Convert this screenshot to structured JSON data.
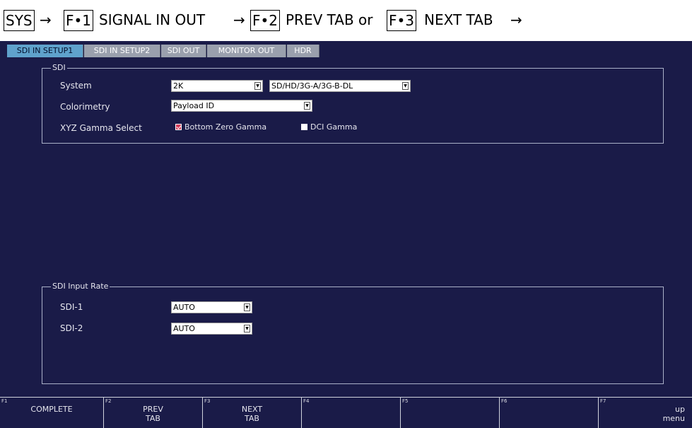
{
  "breadcrumb": {
    "sys": "SYS",
    "arrow": "→",
    "f1_key": "F•1",
    "f1_text": "SIGNAL IN OUT",
    "f2_key": "F•2",
    "f2_text": "PREV TAB or",
    "f3_key": "F•3",
    "f3_text": "NEXT TAB"
  },
  "tabs": [
    {
      "label": "SDI IN SETUP1",
      "active": true
    },
    {
      "label": "SDI IN SETUP2",
      "active": false
    },
    {
      "label": "SDI OUT",
      "active": false
    },
    {
      "label": "MONITOR OUT",
      "active": false
    },
    {
      "label": "HDR",
      "active": false
    }
  ],
  "sdi": {
    "legend": "SDI",
    "system_label": "System",
    "system_value": "2K",
    "system_mode_value": "SD/HD/3G-A/3G-B-DL",
    "colorimetry_label": "Colorimetry",
    "colorimetry_value": "Payload ID",
    "xyz_label": "XYZ Gamma Select",
    "bottom_zero_gamma": "Bottom Zero Gamma",
    "bottom_zero_gamma_checked": true,
    "dci_gamma": "DCI Gamma",
    "dci_gamma_checked": false
  },
  "input_rate": {
    "legend": "SDI Input Rate",
    "sdi1_label": "SDI-1",
    "sdi1_value": "AUTO",
    "sdi2_label": "SDI-2",
    "sdi2_value": "AUTO"
  },
  "fkeys": [
    {
      "num": "F1",
      "label": "COMPLETE"
    },
    {
      "num": "F2",
      "label": "PREV\nTAB"
    },
    {
      "num": "F3",
      "label": "NEXT\nTAB"
    },
    {
      "num": "F4",
      "label": ""
    },
    {
      "num": "F5",
      "label": ""
    },
    {
      "num": "F6",
      "label": ""
    },
    {
      "num": "F7",
      "label": "up\nmenu"
    }
  ],
  "icons": {
    "dropdown": "chevron-down-icon",
    "check": "checkbox-icon"
  },
  "colors": {
    "screen_bg": "#1a1b48",
    "tab_active": "#5fa2cc",
    "tab_inactive": "#9aa0ad",
    "checkbox_on": "#d43b5a"
  }
}
